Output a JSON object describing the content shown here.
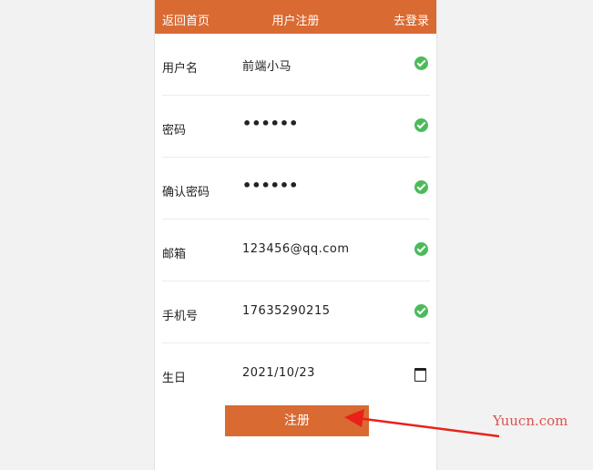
{
  "header": {
    "back_label": "返回首页",
    "title": "用户注册",
    "login_label": "去登录"
  },
  "form": {
    "fields": [
      {
        "label": "用户名",
        "value": "前端小马",
        "status_icon": "check-circle-icon"
      },
      {
        "label": "密码",
        "value": "••••••",
        "status_icon": "check-circle-icon"
      },
      {
        "label": "确认密码",
        "value": "••••••",
        "status_icon": "check-circle-icon"
      },
      {
        "label": "邮箱",
        "value": "123456@qq.com",
        "status_icon": "check-circle-icon"
      },
      {
        "label": "手机号",
        "value": "17635290215",
        "status_icon": "check-circle-icon"
      },
      {
        "label": "生日",
        "value": "2021/10/23",
        "status_icon": "calendar-icon"
      }
    ],
    "submit_label": "注册"
  },
  "watermark": "Yuucn.com",
  "colors": {
    "accent": "#d96a32",
    "success": "#4bbb5a",
    "watermark": "#d9534f"
  }
}
